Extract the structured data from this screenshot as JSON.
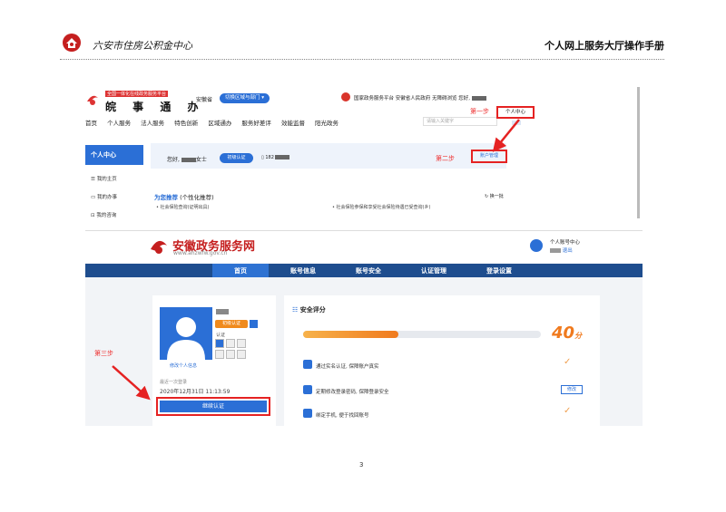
{
  "header": {
    "org": "六安市住房公积金中心",
    "title": "个人网上服务大厅操作手册"
  },
  "shot1": {
    "subtitle": "全国一体化在线政务服务平台",
    "brand": "皖 事 通 办",
    "province": "安徽省",
    "switch_label": "切换区域与部门 ▾",
    "top_right": "国家政务服务平台 安徽省人民政府 无障碍浏览 您好,",
    "nav": [
      "首页",
      "个人服务",
      "法人服务",
      "特色创新",
      "区域通办",
      "服务好差评",
      "效能监督",
      "阳光政务"
    ],
    "search_placeholder": "请输入关键字",
    "step1": "第一步",
    "personal_center": "个人中心",
    "side_title": "个人中心",
    "side_items": [
      "我的主页",
      "我的办事",
      "我的咨询"
    ],
    "greeting": "您好,",
    "greeting_suffix": "女士",
    "verified_badge": "初级认证",
    "phone": "182",
    "step2": "第二步",
    "account_mgmt": "账户管理",
    "recommend_title": "为您推荐",
    "recommend_sub": "(个性化推荐)",
    "refresh": "换一批",
    "items": [
      "社会保险查询(证明出具)",
      "社会保险参保和享受社会保险待遇已受查询(乡)"
    ]
  },
  "shot2": {
    "brand": "安徽政务服务网",
    "url": "www.ahzwfw.gov.cn",
    "user_center": "个人账号中心",
    "logout": "退出",
    "nav": [
      "首页",
      "账号信息",
      "账号安全",
      "认证管理",
      "登录设置"
    ],
    "verified_badge": "初级认证",
    "auth_label": "认证",
    "edit_profile": "修改个人信息",
    "last_login_label": "最近一次登录",
    "last_login": "2020年12月31日 11:13:59",
    "continue_button": "继续认证",
    "step3": "第三步",
    "security_title": "安全评分",
    "score": "40",
    "score_unit": "分",
    "score_fraction": 0.4,
    "rows": [
      "通过实名认证, 保障账户真实",
      "定期修改登录密码, 保障登录安全",
      "绑定手机, 便于找回账号"
    ],
    "modify": "修改"
  },
  "page_number": "3",
  "colors": {
    "accent": "#2b6fd6",
    "brand_red": "#c51f1f",
    "annotation_red": "#e52222",
    "nav_blue": "#1e4d8e",
    "score_orange": "#f07a1e"
  }
}
